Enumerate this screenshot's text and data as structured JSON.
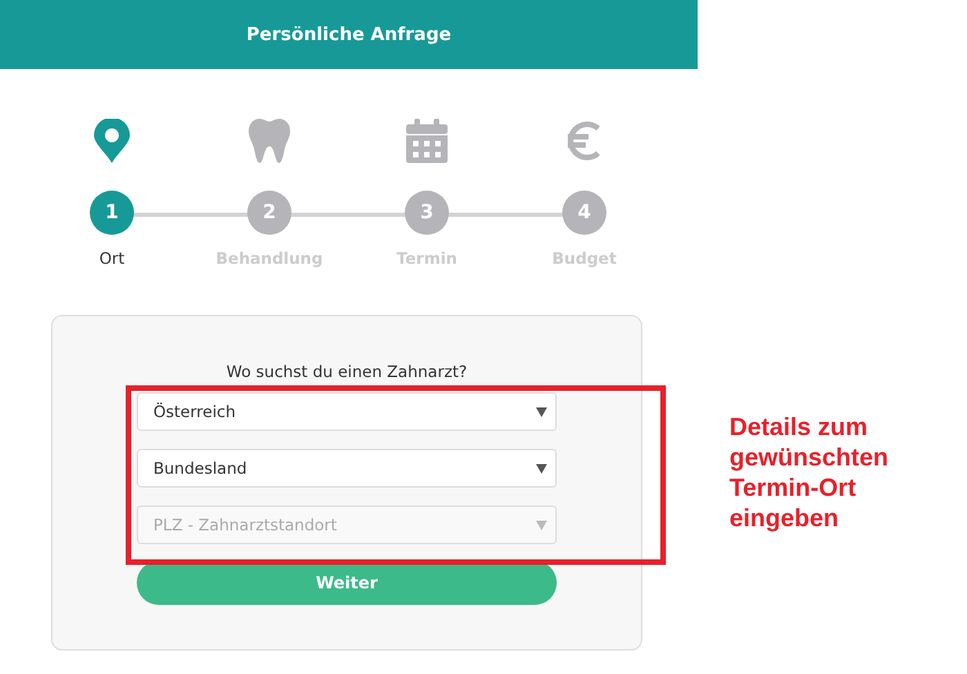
{
  "header": {
    "title": "Persönliche Anfrage"
  },
  "steps": [
    {
      "kind": "pin",
      "number": "1",
      "label": "Ort",
      "selected": true
    },
    {
      "kind": "tooth",
      "number": "2",
      "label": "Behandlung",
      "selected": false
    },
    {
      "kind": "calendar",
      "number": "3",
      "label": "Termin",
      "selected": false
    },
    {
      "kind": "euro",
      "number": "4",
      "label": "Budget",
      "selected": false
    }
  ],
  "form": {
    "question": "Wo suchst du einen Zahnarzt?",
    "dropdowns": [
      {
        "value": "Österreich",
        "disabled": false
      },
      {
        "value": "Bundesland",
        "disabled": false
      },
      {
        "value": "PLZ - Zahnarztstandort",
        "disabled": true
      }
    ],
    "button": "Weiter"
  },
  "annotation": {
    "text": "Details zum gewünschten Termin-Ort eingeben"
  }
}
